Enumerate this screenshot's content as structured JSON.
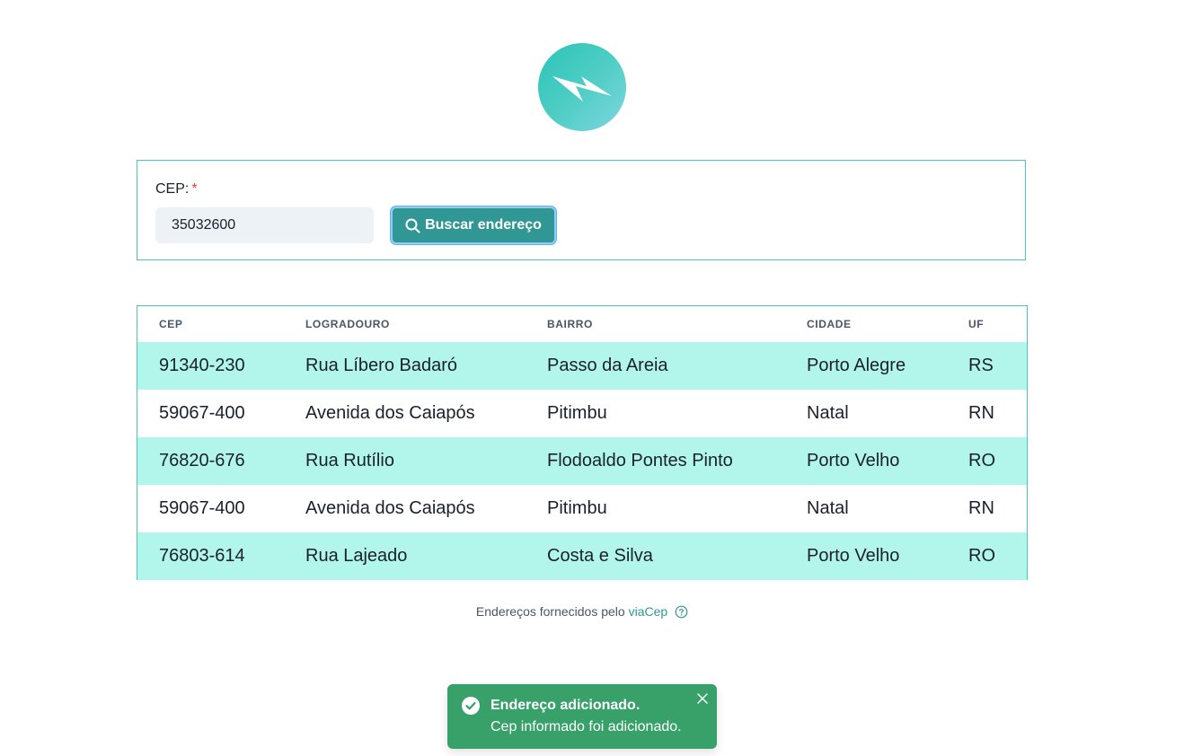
{
  "logo": {
    "icon": "lightning-bolt-icon"
  },
  "form": {
    "label": "CEP:",
    "required_marker": "*",
    "cep_value": "35032600",
    "search_button_label": "Buscar endereço",
    "search_icon": "search-icon"
  },
  "table": {
    "headers": [
      "CEP",
      "LOGRADOURO",
      "BAIRRO",
      "CIDADE",
      "UF"
    ],
    "rows": [
      [
        "91340-230",
        "Rua Líbero Badaró",
        "Passo da Areia",
        "Porto Alegre",
        "RS"
      ],
      [
        "59067-400",
        "Avenida dos Caiapós",
        "Pitimbu",
        "Natal",
        "RN"
      ],
      [
        "76820-676",
        "Rua Rutílio",
        "Flodoaldo Pontes Pinto",
        "Porto Velho",
        "RO"
      ],
      [
        "59067-400",
        "Avenida dos Caiapós",
        "Pitimbu",
        "Natal",
        "RN"
      ],
      [
        "76803-614",
        "Rua Lajeado",
        "Costa e Silva",
        "Porto Velho",
        "RO"
      ]
    ],
    "row_colors": {
      "odd": "#b2f5ea",
      "even": "#ffffff"
    },
    "border_color": "#4fc3b5"
  },
  "footer": {
    "text": "Endereços fornecidos pelo",
    "link_text": "viaCep",
    "help_icon": "question-circle-icon"
  },
  "toast": {
    "title": "Endereço adicionado.",
    "description": "Cep informado foi adicionado.",
    "status": "success",
    "color": "#38a169",
    "icon": "check-circle-icon",
    "close_icon": "close-icon"
  },
  "colors": {
    "accent": "#319795",
    "required": "#e53e3e"
  }
}
